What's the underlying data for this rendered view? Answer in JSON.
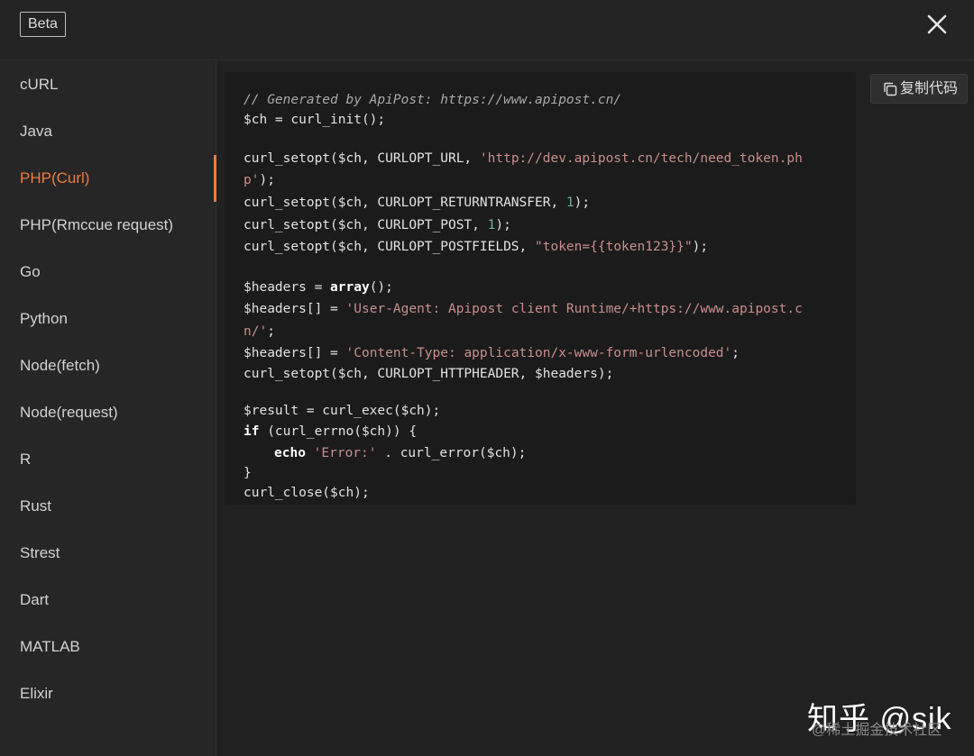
{
  "header": {
    "badge": "Beta"
  },
  "sidebar": {
    "items": [
      {
        "label": "cURL"
      },
      {
        "label": "Java"
      },
      {
        "label": "PHP(Curl)"
      },
      {
        "label": "PHP(Rmccue request)"
      },
      {
        "label": "Go"
      },
      {
        "label": "Python"
      },
      {
        "label": "Node(fetch)"
      },
      {
        "label": "Node(request)"
      },
      {
        "label": "R"
      },
      {
        "label": "Rust"
      },
      {
        "label": "Strest"
      },
      {
        "label": "Dart"
      },
      {
        "label": "MATLAB"
      },
      {
        "label": "Elixir"
      }
    ],
    "active_label": "PHP(Curl)"
  },
  "toolbar": {
    "copy_label": "复制代码"
  },
  "code": {
    "comment": "// Generated by ApiPost: https://www.apipost.cn/",
    "l_init": "$ch = curl_init();",
    "l_url_a": "curl_setopt($ch, CURLOPT_URL, ",
    "l_url_str1": "'http://dev.apipost.cn/tech/need_token.ph",
    "l_url_str2": "p'",
    "l_url_end": ");",
    "l_rt_a": "curl_setopt($ch, CURLOPT_RETURNTRANSFER, ",
    "l_rt_num": "1",
    "l_rt_end": ");",
    "l_post_a": "curl_setopt($ch, CURLOPT_POST, ",
    "l_post_num": "1",
    "l_post_end": ");",
    "l_pf_a": "curl_setopt($ch, CURLOPT_POSTFIELDS, ",
    "l_pf_str": "\"token={{token123}}\"",
    "l_pf_end": ");",
    "l_h_a": "$headers = ",
    "l_h_kw": "array",
    "l_h_end": "();",
    "l_ua_a": "$headers[] = ",
    "l_ua_str1": "'User-Agent: Apipost client Runtime/+https://www.apipost.c",
    "l_ua_str2": "n/'",
    "l_ua_end": ";",
    "l_ct_a": "$headers[] = ",
    "l_ct_str": "'Content-Type: application/x-www-form-urlencoded'",
    "l_ct_end": ";",
    "l_hh": "curl_setopt($ch, CURLOPT_HTTPHEADER, $headers);",
    "l_res": "$result = curl_exec($ch);",
    "l_if_kw": "if",
    "l_if_rest": " (curl_errno($ch)) {",
    "l_echo_kw": "echo",
    "l_echo_str": "'Error:'",
    "l_echo_rest": " . curl_error($ch);",
    "l_close_brace": "}",
    "l_close": "curl_close($ch);"
  },
  "watermark": {
    "main": "知乎 @sik",
    "sub": "@稀土掘金技术社区"
  },
  "colors": {
    "accent": "#ef7a3c",
    "string": "#c98d8d",
    "number": "#6fb391",
    "comment": "#a9a9a9"
  },
  "icons": {
    "close": "close-icon",
    "copy": "copy-icon"
  }
}
